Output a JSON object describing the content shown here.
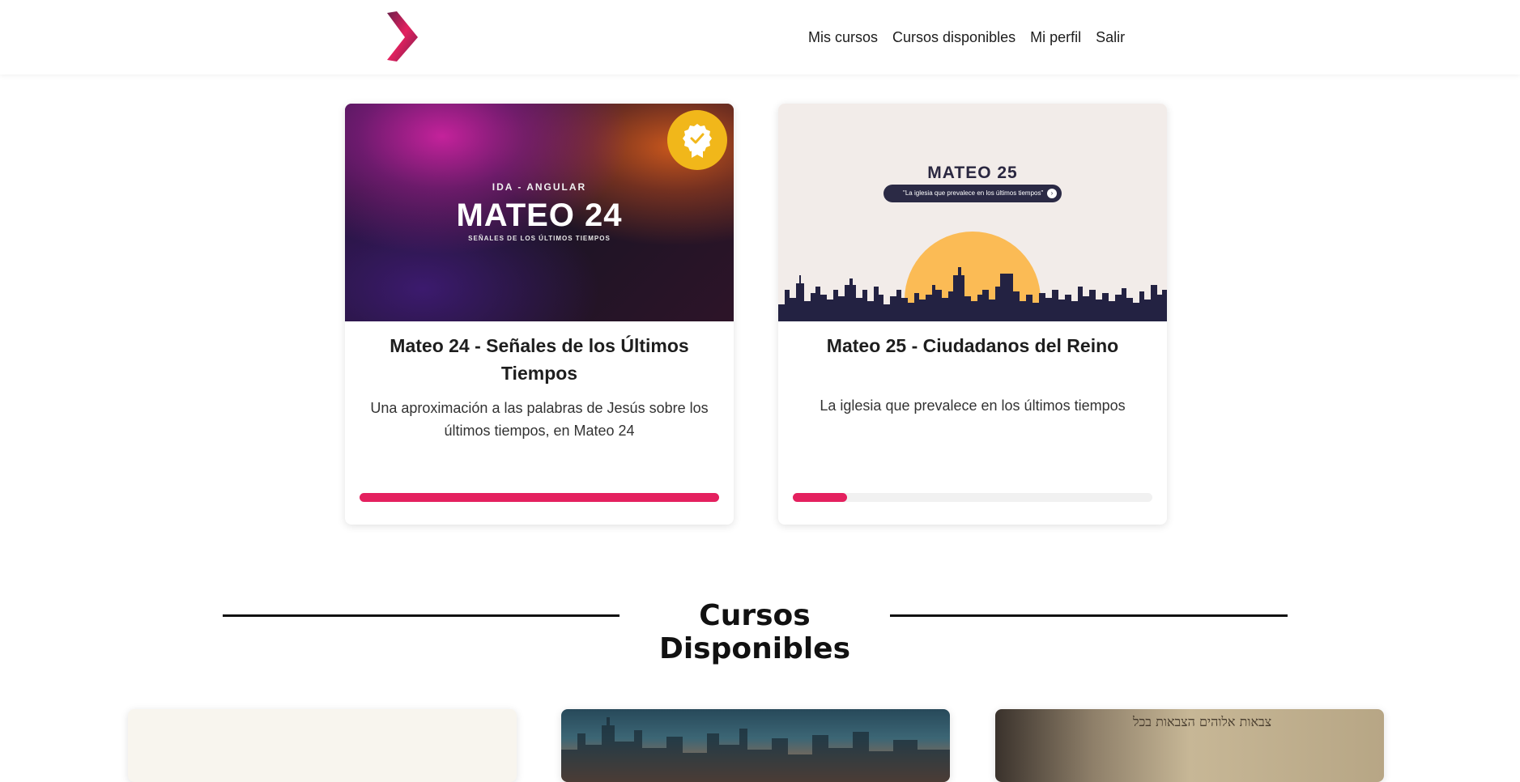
{
  "header": {
    "nav": [
      "Mis cursos",
      "Cursos disponibles",
      "Mi perfil",
      "Salir"
    ]
  },
  "my_courses": [
    {
      "image": {
        "kicker": "IDA - ANGULAR",
        "headline": "MATEO 24",
        "subtitle": "SEÑALES DE LOS ÚLTIMOS TIEMPOS",
        "badge_icon": "certificate-badge-icon"
      },
      "title": "Mateo 24 - Señales de los Últimos Tiempos",
      "description": "Una aproximación a las palabras de Jesús sobre los últimos tiempos, en Mateo 24",
      "progress_percent": 100
    },
    {
      "image": {
        "headline": "MATEO 25",
        "tagline": "\"La iglesia que prevalece en los últimos tiempos\"",
        "tagline_icon": "arrow-right-icon"
      },
      "title": "Mateo 25 - Ciudadanos del Reino",
      "description": "La iglesia que prevalece en los últimos tiempos",
      "progress_percent": 15
    }
  ],
  "available_section": {
    "title": "Cursos Disponibles"
  },
  "available_courses_preview": [
    {
      "image_icon": "course-thumbnail"
    },
    {
      "image_icon": "city-night-thumbnail"
    },
    {
      "image_icon": "hebrew-scroll-thumbnail",
      "text": "צבאות אלוהים הצבאות בכל"
    }
  ],
  "colors": {
    "accent": "#e4215f",
    "badge": "#f1b71a",
    "sun": "#fbbb55",
    "navy": "#2b2a45"
  }
}
